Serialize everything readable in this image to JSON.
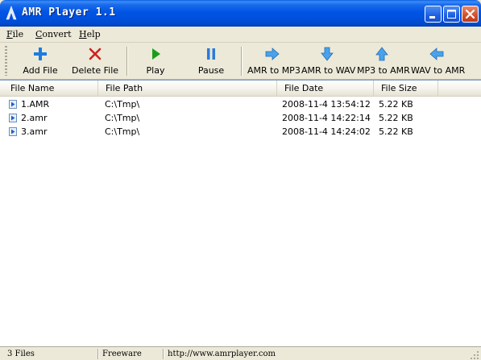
{
  "window": {
    "title": "AMR Player 1.1",
    "controls": [
      "minimize-icon",
      "maximize-icon",
      "close-icon"
    ]
  },
  "menu": [
    {
      "accel": "F",
      "rest": "ile"
    },
    {
      "accel": "C",
      "rest": "onvert"
    },
    {
      "accel": "H",
      "rest": "elp"
    }
  ],
  "toolbar": {
    "add_file": "Add File",
    "delete_file": "Delete File",
    "play": "Play",
    "pause": "Pause",
    "amr_to_mp3": "AMR to MP3",
    "amr_to_wav": "AMR to WAV",
    "mp3_to_amr": "MP3 to AMR",
    "wav_to_amr": "WAV to AMR"
  },
  "columns": [
    "File Name",
    "File Path",
    "File Date",
    "File Size"
  ],
  "rows": [
    {
      "name": "1.AMR",
      "path": "C:\\Tmp\\",
      "date": "2008-11-4 13:54:12",
      "size": "5.22 KB"
    },
    {
      "name": "2.amr",
      "path": "C:\\Tmp\\",
      "date": "2008-11-4 14:22:14",
      "size": "5.22 KB"
    },
    {
      "name": "3.amr",
      "path": "C:\\Tmp\\",
      "date": "2008-11-4 14:24:02",
      "size": "5.22 KB"
    }
  ],
  "status": {
    "count": "3 Files",
    "license": "Freeware",
    "url": "http://www.amrplayer.com"
  },
  "colors": {
    "titlebar": "#0055e5",
    "add_icon": "#1e7be0",
    "delete_icon": "#d22020",
    "play_icon": "#1a9e1a",
    "pause_icon": "#2a7bd6",
    "arrow_icon": "#4aa3ea"
  }
}
